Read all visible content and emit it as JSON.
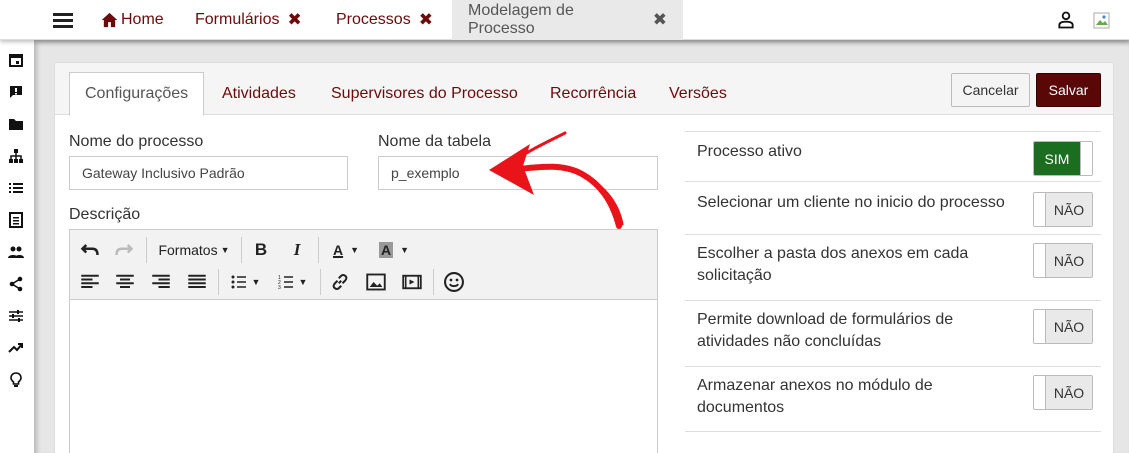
{
  "topbar": {
    "tabs": [
      {
        "label": "Home"
      },
      {
        "label": "Formulários"
      },
      {
        "label": "Processos"
      },
      {
        "label": "Modelagem de Processo"
      }
    ],
    "close_glyph": "✖",
    "accent_color": "#6b0b0b"
  },
  "sidebar": {
    "icons": [
      "calendar-icon",
      "feedback-icon",
      "folder-icon",
      "sitemap-icon",
      "list-icon",
      "document-list-icon",
      "people-icon",
      "share-icon",
      "sliders-icon",
      "trending-up-icon",
      "lightbulb-icon"
    ]
  },
  "process_tabs": {
    "items": [
      {
        "label": "Configurações",
        "active": true
      },
      {
        "label": "Atividades"
      },
      {
        "label": "Supervisores do Processo"
      },
      {
        "label": "Recorrência"
      },
      {
        "label": "Versões"
      }
    ]
  },
  "actions": {
    "cancel_label": "Cancelar",
    "save_label": "Salvar",
    "save_color": "#5a0707"
  },
  "form": {
    "process_name_label": "Nome do processo",
    "process_name_value": "Gateway Inclusivo Padrão",
    "table_name_label": "Nome da tabela",
    "table_name_value": "p_exemplo",
    "description_label": "Descrição",
    "description_value": ""
  },
  "editor": {
    "formats_label": "Formatos"
  },
  "options": [
    {
      "label": "Processo ativo",
      "value": "SIM"
    },
    {
      "label": "Selecionar um cliente no inicio do processo",
      "value": "NÃO"
    },
    {
      "label": "Escolher a pasta dos anexos em cada solicitação",
      "value": "NÃO"
    },
    {
      "label": "Permite download de formulários de atividades não concluídas",
      "value": "NÃO"
    },
    {
      "label": "Armazenar anexos no módulo de documentos",
      "value": "NÃO"
    }
  ],
  "annotation": {
    "arrow_color": "#e8141a"
  }
}
